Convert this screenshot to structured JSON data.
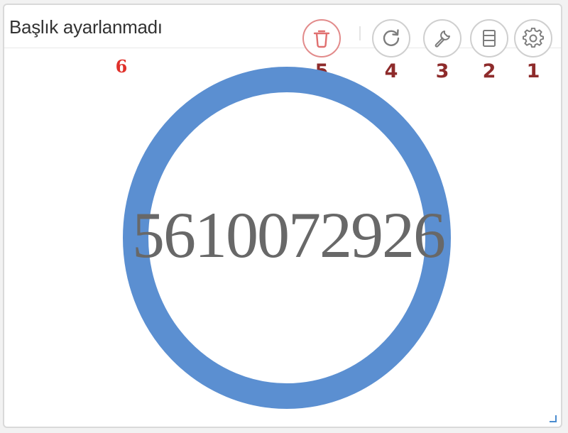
{
  "widget": {
    "title": "Başlık ayarlanmadı",
    "value": "5610072926",
    "gauge_color": "#5b8fd1"
  },
  "toolbar": {
    "buttons": [
      {
        "icon": "trash-icon",
        "marker": "5"
      },
      {
        "icon": "refresh-icon",
        "marker": "4"
      },
      {
        "icon": "wrench-icon",
        "marker": "3"
      },
      {
        "icon": "list-icon",
        "marker": "2"
      },
      {
        "icon": "gear-icon",
        "marker": "1"
      }
    ]
  },
  "annotations": {
    "title_marker": "6"
  },
  "colors": {
    "marker": "#8e2b2b",
    "title_marker": "#e0312b",
    "delete_accent": "#e07070",
    "icon_gray": "#7d7d7d"
  }
}
